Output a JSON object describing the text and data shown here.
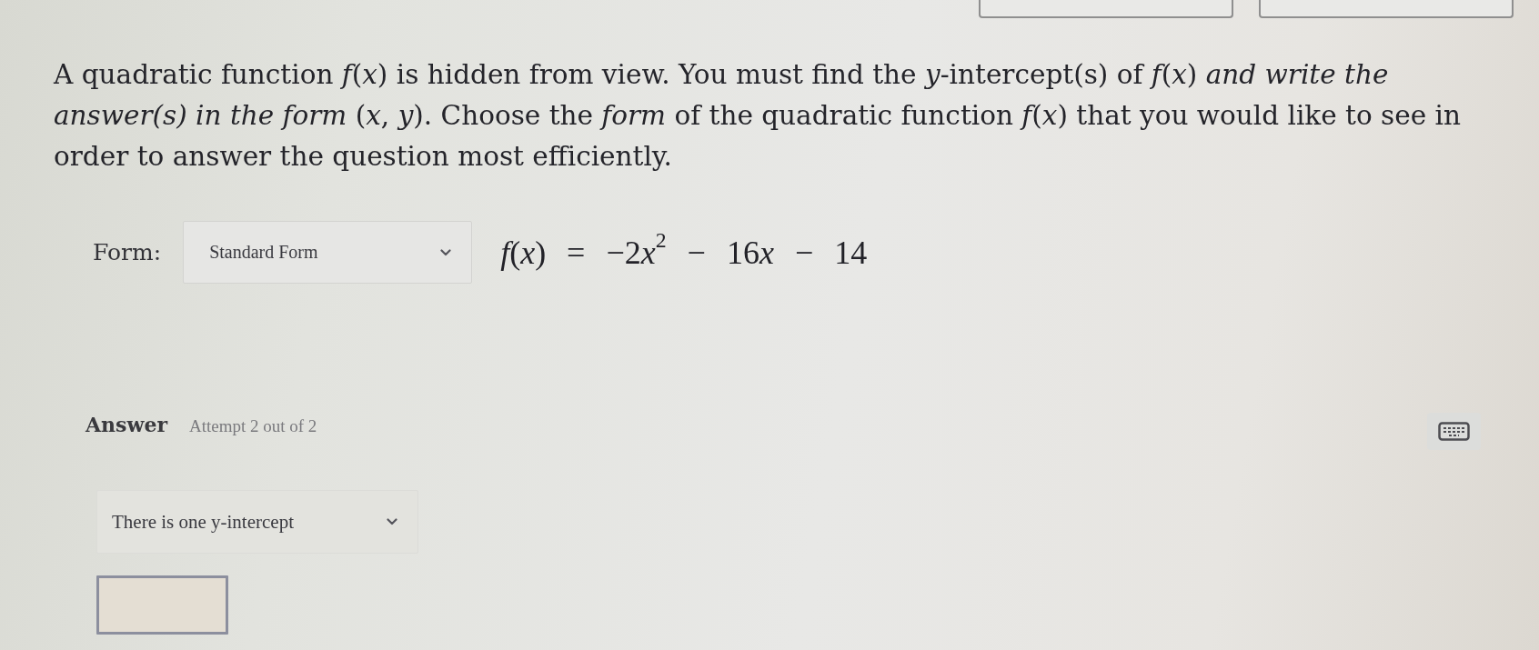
{
  "header_buttons": [
    {
      "kind": "outlined"
    },
    {
      "kind": "outlined"
    }
  ],
  "question": {
    "text": "A quadratic function *f*(*x*) is hidden from view. You must find the *y*-intercept(s) of *f*(*x*) *and write the answer(s) in the form* (*x*, *y*). Choose the *form* of the quadratic function *f*(*x*) that you would like to see in order to answer the question most efficiently."
  },
  "form": {
    "label": "Form:",
    "select": {
      "value": "Standard Form"
    },
    "equation": "f(x) = −2x$^{2}$ − 16x − 14"
  },
  "answer": {
    "heading": "Answer",
    "attempt": "Attempt 2 out of 2",
    "tools": [
      {
        "kind": "keyboard"
      }
    ],
    "select": {
      "value": "There is one y-intercept"
    },
    "inputs": [
      {
        "kind": "text"
      }
    ]
  }
}
